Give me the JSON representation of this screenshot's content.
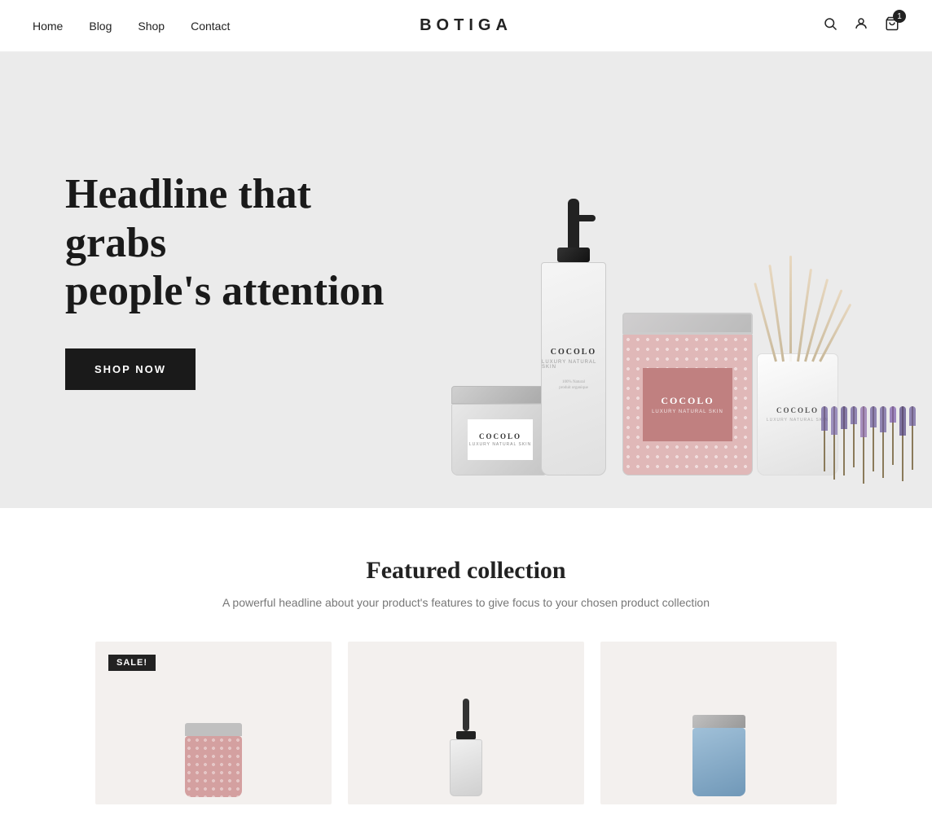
{
  "nav": {
    "links": [
      {
        "label": "Home",
        "href": "#"
      },
      {
        "label": "Blog",
        "href": "#"
      },
      {
        "label": "Shop",
        "href": "#"
      },
      {
        "label": "Contact",
        "href": "#"
      }
    ],
    "logo": "BOTIGA",
    "cart_count": "1"
  },
  "hero": {
    "headline_line1": "Headline that grabs",
    "headline_line2": "people's attention",
    "cta_label": "SHOP NOW"
  },
  "featured": {
    "title": "Featured collection",
    "subtitle": "A powerful headline about your product's features to give focus to your chosen product collection",
    "sale_badge": "SALE!"
  }
}
